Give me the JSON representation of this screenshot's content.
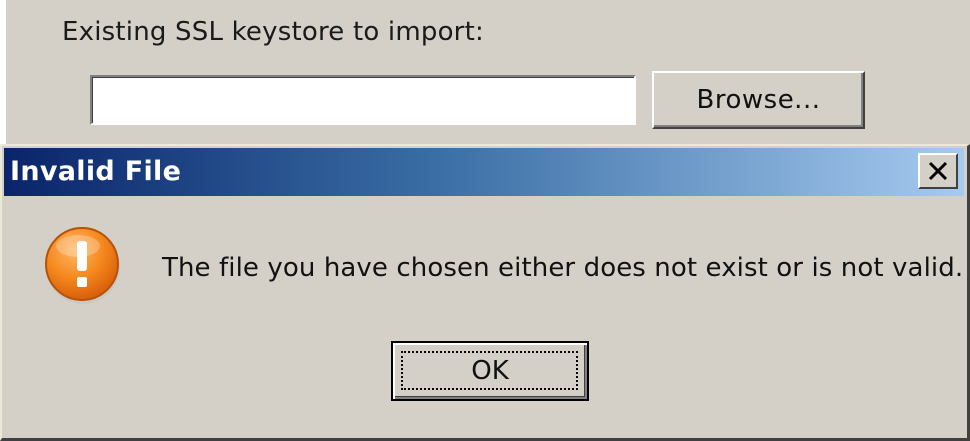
{
  "background_window": {
    "keystore_label": "Existing SSL keystore to import:",
    "path_value": "",
    "browse_label": "Browse..."
  },
  "dialog": {
    "title": "Invalid File",
    "close_label": "✕",
    "icon": "warning-icon",
    "message": "The file you have chosen either does not exist or is not valid.",
    "ok_label": "OK"
  },
  "colors": {
    "window_background": "#d4d0c8",
    "titlebar_start": "#0a246a",
    "titlebar_end": "#a6caf0",
    "warning_orange": "#f07a16"
  }
}
